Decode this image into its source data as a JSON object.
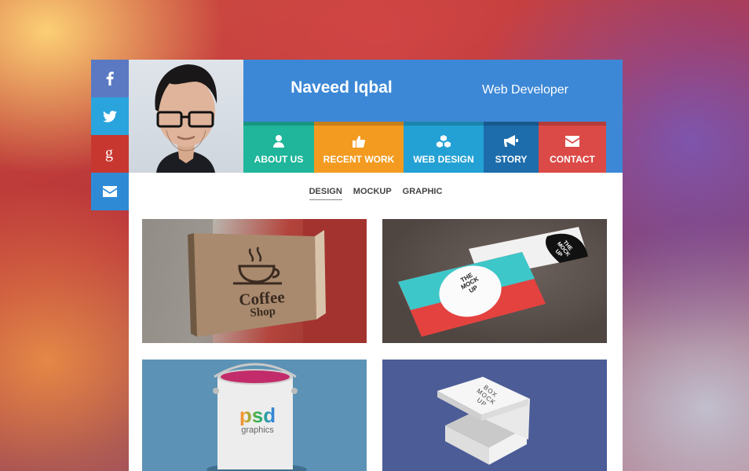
{
  "profile": {
    "name": "Naveed Iqbal",
    "role": "Web Developer"
  },
  "social": [
    {
      "icon": "facebook-icon",
      "color": "#5a79c2"
    },
    {
      "icon": "twitter-icon",
      "color": "#2aa4dc"
    },
    {
      "icon": "google-plus-icon",
      "color": "#c8372f"
    },
    {
      "icon": "envelope-icon",
      "color": "#2f8ad6"
    }
  ],
  "nav": [
    {
      "label": "ABOUT US",
      "icon": "user-icon",
      "color": "#1fb69b"
    },
    {
      "label": "RECENT WORK",
      "icon": "thumbs-up-icon",
      "color": "#f39b20"
    },
    {
      "label": "WEB DESIGN",
      "icon": "cubes-icon",
      "color": "#23a1d4"
    },
    {
      "label": "STORY",
      "icon": "bullhorn-icon",
      "color": "#1d6dac"
    },
    {
      "label": "CONTACT",
      "icon": "envelope-icon",
      "color": "#db4a47"
    }
  ],
  "filters": [
    "DESIGN",
    "MOCKUP",
    "GRAPHIC"
  ],
  "active_filter": "DESIGN",
  "gallery": [
    {
      "caption_lines": [
        "Coffee",
        "Shop"
      ]
    },
    {
      "card_text": [
        "THE",
        "MOCK",
        "UP"
      ]
    },
    {
      "logo_main": "psd",
      "logo_sub": "graphics"
    },
    {
      "box_text": [
        "BOX",
        "MOCK",
        "UP"
      ]
    }
  ]
}
